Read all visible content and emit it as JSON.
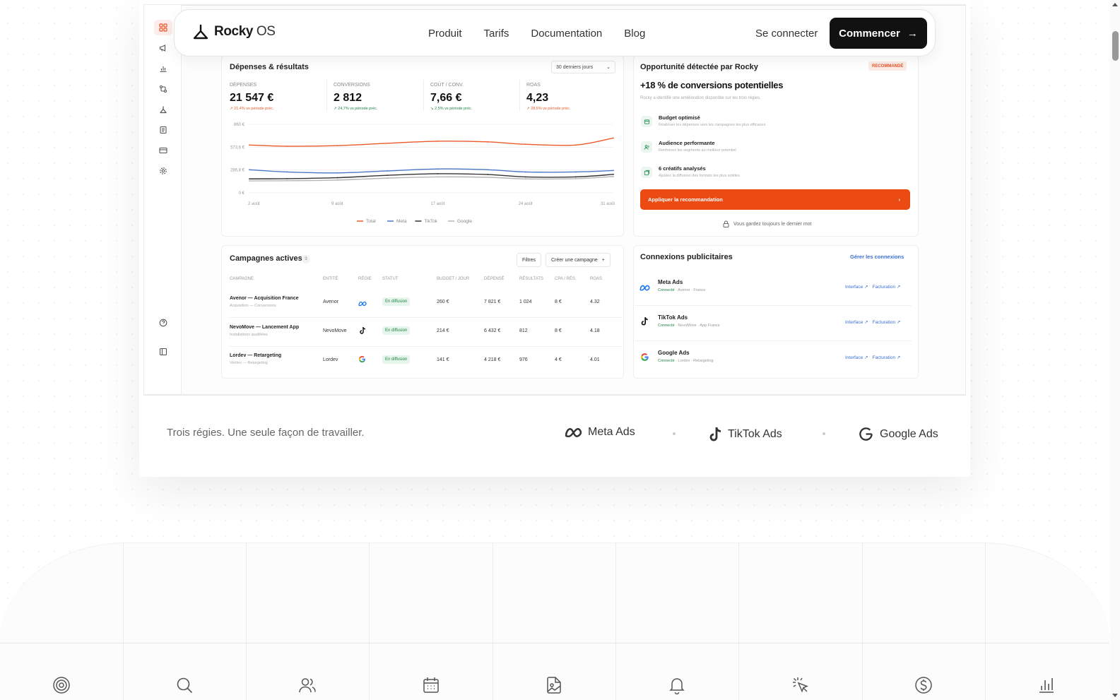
{
  "navbar": {
    "brand_name": "Rocky",
    "brand_os": "OS",
    "links": [
      "Produit",
      "Tarifs",
      "Documentation",
      "Blog"
    ],
    "login": "Se connecter",
    "cta": "Commencer"
  },
  "spend": {
    "title": "Dépenses & résultats",
    "period": "30 derniers jours",
    "kpis": [
      {
        "label": "Dépenses",
        "value": "21 547 €",
        "delta": "↗ 21,4% vs période préc."
      },
      {
        "label": "Conversions",
        "value": "2 812",
        "delta": "↗ 24,7% vs période préc."
      },
      {
        "label": "Coût / conv.",
        "value": "7,66 €",
        "delta": "↘ 2,5% vs période préc."
      },
      {
        "label": "ROAS",
        "value": "4,23",
        "delta": "↗ 28,5% vs période préc."
      }
    ]
  },
  "chart_data": {
    "type": "line",
    "title": "",
    "xlabel": "",
    "ylabel": "",
    "y_ticks": [
      "860 €",
      "573,6 €",
      "286,8 €",
      "0 €"
    ],
    "ylim": [
      0,
      860
    ],
    "x_ticks": [
      "2 août",
      "9 août",
      "17 août",
      "24 août",
      "31 août"
    ],
    "x": [
      2,
      5,
      9,
      13,
      17,
      21,
      24,
      28,
      31
    ],
    "series": [
      {
        "name": "Total",
        "color": "#eb5a2a",
        "values": [
          600,
          585,
          592,
          622,
          648,
          640,
          610,
          600,
          688
        ]
      },
      {
        "name": "Meta",
        "color": "#4a78c8",
        "values": [
          290,
          262,
          250,
          275,
          300,
          290,
          262,
          262,
          280
        ]
      },
      {
        "name": "TikTok",
        "color": "#333333",
        "values": [
          175,
          178,
          190,
          220,
          240,
          230,
          200,
          200,
          232
        ]
      },
      {
        "name": "Google",
        "color": "#b5b5b5",
        "values": [
          150,
          152,
          160,
          185,
          200,
          195,
          175,
          178,
          205
        ]
      }
    ],
    "legend_position": "bottom",
    "grid": true
  },
  "opportunity": {
    "title": "Opportunité détectée par Rocky",
    "badge": "RECOMMANDÉ",
    "headline": "+18 % de conversions potentielles",
    "sub": "Rocky a identifié une amélioration disponible sur les trois régies.",
    "items": [
      {
        "title": "Budget optimisé",
        "sub": "Réallouer les dépenses vers les campagnes les plus efficaces"
      },
      {
        "title": "Audience performante",
        "sub": "Renforcez les segments au meilleur potentiel"
      },
      {
        "title": "6 créatifs analysés",
        "sub": "Ajustez la diffusion des formats les plus solides"
      }
    ],
    "apply": "Appliquer la recommandation",
    "note": "Vous gardez toujours le dernier mot"
  },
  "campaigns": {
    "title": "Campagnes actives",
    "count": "3",
    "filters": "Filtres",
    "create": "Créer une campagne",
    "headers": [
      "Campagne",
      "Entité",
      "Régie",
      "Statut",
      "Budget / jour",
      "Dépensé",
      "Résultats",
      "CPA / rés.",
      "ROAS"
    ],
    "rows": [
      {
        "name": "Avenor — Acquisition France",
        "sub": "Acquisition — Conversions",
        "entity": "Avenor",
        "network": "meta",
        "status": "En diffusion",
        "budget": "260 €",
        "spent": "7 821 €",
        "results": "1 024",
        "cpa": "8 €",
        "roas": "4.32"
      },
      {
        "name": "NevoMove — Lancement App",
        "sub": "Installations qualifiées",
        "entity": "NevoMove",
        "network": "tiktok",
        "status": "En diffusion",
        "budget": "214 €",
        "spent": "6 432 €",
        "results": "812",
        "cpa": "8 €",
        "roas": "4.18"
      },
      {
        "name": "Lordev — Retargeting",
        "sub": "Ventes — Retargeting",
        "entity": "Lordev",
        "network": "google",
        "status": "En diffusion",
        "budget": "141 €",
        "spent": "4 218 €",
        "results": "976",
        "cpa": "4 €",
        "roas": "4.01"
      }
    ]
  },
  "connections": {
    "title": "Connexions publicitaires",
    "manage": "Gérer les connexions",
    "items": [
      {
        "name": "Meta Ads",
        "status": "Connecté",
        "detail": " · Avenor · France",
        "l1": "Interface",
        "l2": "Facturation"
      },
      {
        "name": "TikTok Ads",
        "status": "Connecté",
        "detail": " · NevoMove · App France",
        "l1": "Interface",
        "l2": "Facturation"
      },
      {
        "name": "Google Ads",
        "status": "Connecté",
        "detail": " · Lordev · Retargeting",
        "l1": "Interface",
        "l2": "Facturation"
      }
    ]
  },
  "trust": {
    "text": "Trois régies. Une seule façon de travailler.",
    "networks": [
      "Meta Ads",
      "TikTok Ads",
      "Google Ads"
    ]
  },
  "features": {
    "icons": [
      "target-icon",
      "search-icon",
      "users-icon",
      "calendar-icon",
      "image-file-icon",
      "bell-icon",
      "cursor-click-icon",
      "dollar-icon",
      "bar-chart-icon"
    ]
  }
}
